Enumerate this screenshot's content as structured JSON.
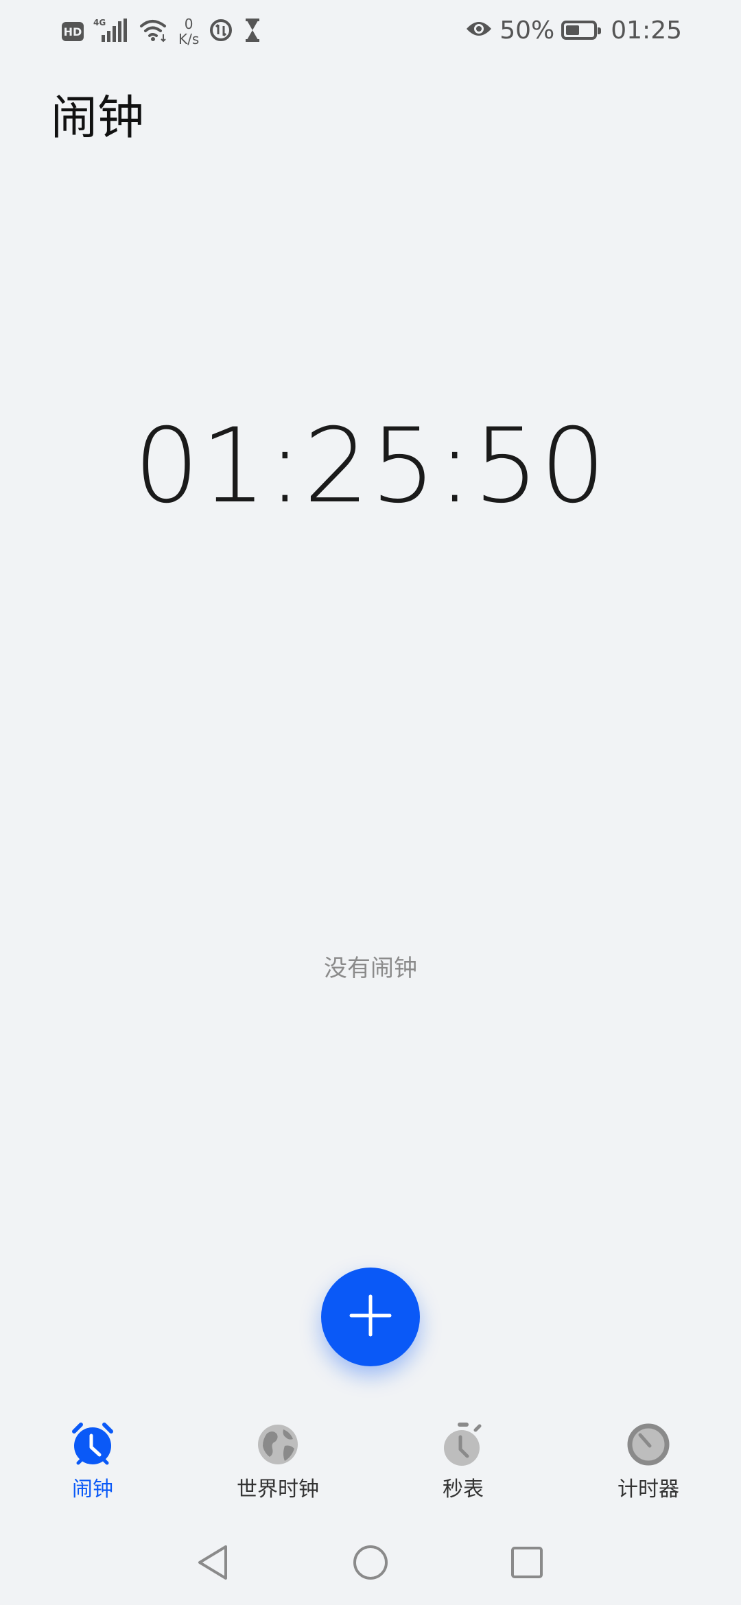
{
  "status_bar": {
    "hd_label": "HD",
    "network_label": "4G",
    "speed_value": "0",
    "speed_unit": "K/s",
    "battery_percent": "50%",
    "battery_level": 0.5,
    "time": "01:25"
  },
  "header": {
    "title": "闹钟"
  },
  "clock": {
    "time": "01:25:50"
  },
  "empty_state": {
    "message": "没有闹钟"
  },
  "fab": {
    "icon": "plus-icon"
  },
  "tabs": [
    {
      "label": "闹钟",
      "icon": "alarm-clock-icon",
      "active": true
    },
    {
      "label": "世界时钟",
      "icon": "globe-icon",
      "active": false
    },
    {
      "label": "秒表",
      "icon": "stopwatch-icon",
      "active": false
    },
    {
      "label": "计时器",
      "icon": "timer-icon",
      "active": false
    }
  ],
  "nav_bar": {
    "back_icon": "back-triangle-icon",
    "home_icon": "home-circle-icon",
    "recents_icon": "recents-square-icon"
  },
  "colors": {
    "accent": "#0a59f7",
    "background": "#f1f3f5",
    "inactive_icon": "#9e9e9e"
  }
}
